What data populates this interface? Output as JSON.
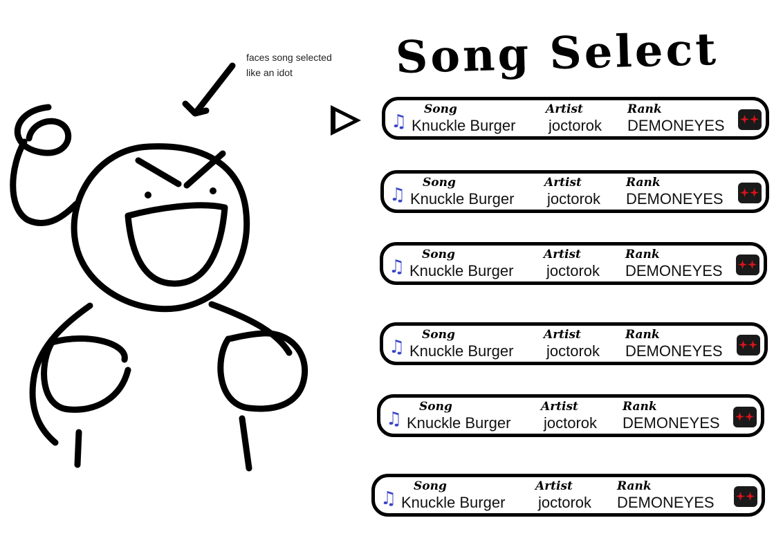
{
  "annotation": "faces song selected like an idot",
  "title": "Song Select",
  "songs": [
    {
      "song_label": "Song",
      "song": "Knuckle Burger",
      "artist_label": "Artist",
      "artist": "joctorok",
      "rank_label": "Rank",
      "rank": "DEMONEYES",
      "selected": true
    },
    {
      "song_label": "Song",
      "song": "Knuckle Burger",
      "artist_label": "Artist",
      "artist": "joctorok",
      "rank_label": "Rank",
      "rank": "DEMONEYES",
      "selected": false
    },
    {
      "song_label": "Song",
      "song": "Knuckle Burger",
      "artist_label": "Artist",
      "artist": "joctorok",
      "rank_label": "Rank",
      "rank": "DEMONEYES",
      "selected": false
    },
    {
      "song_label": "Song",
      "song": "Knuckle Burger",
      "artist_label": "Artist",
      "artist": "joctorok",
      "rank_label": "Rank",
      "rank": "DEMONEYES",
      "selected": false
    },
    {
      "song_label": "Song",
      "song": "Knuckle Burger",
      "artist_label": "Artist",
      "artist": "joctorok",
      "rank_label": "Rank",
      "rank": "DEMONEYES",
      "selected": false
    },
    {
      "song_label": "Song",
      "song": "Knuckle Burger",
      "artist_label": "Artist",
      "artist": "joctorok",
      "rank_label": "Rank",
      "rank": "DEMONEYES",
      "selected": false
    }
  ],
  "icons": {
    "song": "music-note-icon",
    "rank": "demon-eyes-icon",
    "pointer": "arrow-icon",
    "selector": "triangle-selector-icon"
  },
  "colors": {
    "note": "#3a44c8",
    "rank_eye": "#d6141c",
    "rank_bg": "#1a1a1a",
    "stroke": "#000000"
  }
}
